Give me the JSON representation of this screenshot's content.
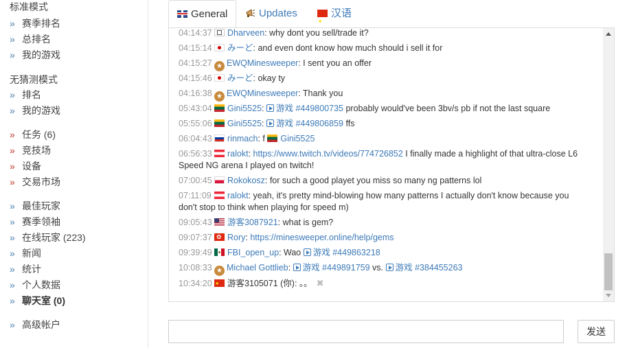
{
  "sidebar": {
    "standard_title": "标准模式",
    "standard_items": [
      "赛季排名",
      "总排名",
      "我的游戏"
    ],
    "nog_title": "无猜测模式",
    "nog_items": [
      "排名",
      "我的游戏"
    ],
    "misc_items": [
      "任务 (6)",
      "竞技场",
      "设备",
      "交易市场"
    ],
    "social_items": [
      "最佳玩家",
      "赛季领袖",
      "在线玩家 (223)",
      "新闻",
      "统计",
      "个人数据",
      "聊天室 (0)"
    ],
    "premium_item": "高级帐户"
  },
  "tabs": [
    {
      "label": "General",
      "flag": "gb-flag"
    },
    {
      "label": "Updates",
      "flag": "megaphone-icon"
    },
    {
      "label": "汉语",
      "flag": "cn-flag"
    }
  ],
  "messages": [
    {
      "time": "04:14:37",
      "flag": "ar",
      "user": "Dharveen",
      "text": ": why dont you sell/trade it?"
    },
    {
      "time": "04:15:14",
      "flag": "jp",
      "user": "みーど",
      "text": ": and even dont know how much should i sell it for"
    },
    {
      "time": "04:15:27",
      "flag": "star",
      "user": "EWQMinesweeper",
      "text": ": I sent you an offer"
    },
    {
      "time": "04:15:46",
      "flag": "jp",
      "user": "みーど",
      "text": ": okay ty"
    },
    {
      "time": "04:16:38",
      "flag": "star",
      "user": "EWQMinesweeper",
      "text": ": Thank you"
    },
    {
      "time": "05:43:04",
      "flag": "lt",
      "user": "Gini5525",
      "game": "游戏 #449800735",
      "text": " probably would've been 3bv/s pb if not the last square"
    },
    {
      "time": "05:55:06",
      "flag": "lt",
      "user": "Gini5525",
      "game": "游戏 #449806859",
      "text": " ffs"
    },
    {
      "time": "06:04:43",
      "flag": "ru",
      "user": "rinmach",
      "text": ": f ",
      "mention": "Gini5525"
    },
    {
      "time": "06:56:33",
      "flag": "at",
      "user": "ralokt",
      "link": "https://www.twitch.tv/videos/774726852",
      "text": " I finally made a highlight of that ultra-close L6",
      "text2": "Speed NG arena I played on twitch!"
    },
    {
      "time": "07:00:45",
      "flag": "pl",
      "user": "Rokokosz",
      "text": ": for such a good playet you miss so many ng patterns lol"
    },
    {
      "time": "07:11:09",
      "flag": "at",
      "user": "ralokt",
      "text": ": yeah, it's pretty mind-blowing how many patterns I actually don't know because you",
      "text2": "don't stop to think when playing for speed m)"
    },
    {
      "time": "09:05:43",
      "flag": "us",
      "user": "游客3087921",
      "text": ": what is gem?"
    },
    {
      "time": "09:07:37",
      "flag": "hk",
      "user": "Rory",
      "link": "https://minesweeper.online/help/gems",
      "text": ""
    },
    {
      "time": "09:39:49",
      "flag": "mx",
      "user": "FBI_open_up",
      "text": ": Wao ",
      "game": "游戏 #449863218"
    },
    {
      "time": "10:08:33",
      "flag": "star",
      "user": "Michael Gottlieb",
      "game": "游戏 #449891759",
      "text": " vs. ",
      "game2": "游戏 #384455263"
    },
    {
      "time": "10:34:20",
      "flag": "cn",
      "user": "游客3105071",
      "text": " (你): 。。"
    }
  ],
  "input": {
    "value": "",
    "placeholder": ""
  },
  "send_label": "发送",
  "colors": {
    "link": "#3d7ab8",
    "time": "#999999",
    "chevron": "#4a7fae",
    "chevron_red": "#c0392b"
  }
}
